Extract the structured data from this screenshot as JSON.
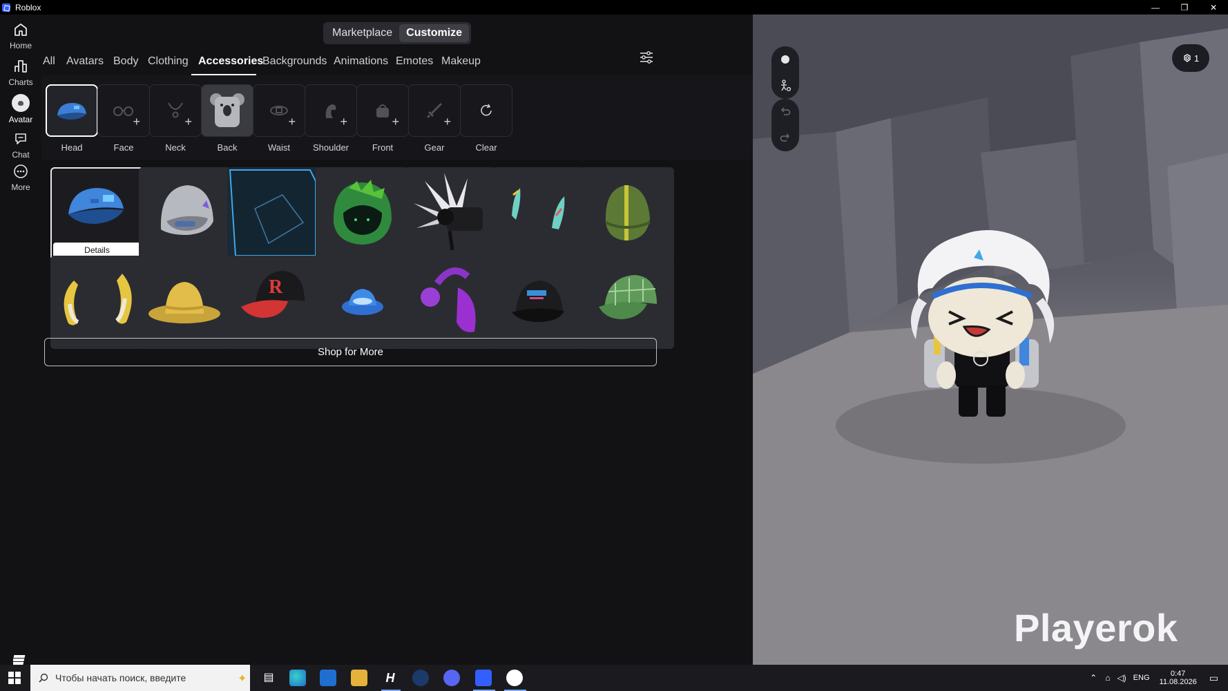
{
  "window": {
    "title": "Roblox",
    "minimize": "—",
    "restore": "❐",
    "close": "✕"
  },
  "nav": {
    "items": [
      {
        "label": "Home",
        "icon": "home-icon"
      },
      {
        "label": "Charts",
        "icon": "charts-icon"
      },
      {
        "label": "Avatar",
        "icon": "avatar-icon"
      },
      {
        "label": "Chat",
        "icon": "chat-icon"
      },
      {
        "label": "More",
        "icon": "more-icon"
      }
    ]
  },
  "header": {
    "segments": [
      "Marketplace",
      "Customize"
    ],
    "active_segment": "Customize"
  },
  "tabs": [
    "All",
    "Avatars",
    "Body",
    "Clothing",
    "Accessories",
    "Backgrounds",
    "Animations",
    "Emotes",
    "Makeup"
  ],
  "active_tab": "Accessories",
  "subcategories": [
    "Head",
    "Face",
    "Neck",
    "Back",
    "Waist",
    "Shoulder",
    "Front",
    "Gear",
    "Clear"
  ],
  "active_subcategory": "Head",
  "items": {
    "details_label": "Details",
    "list": [
      "blue-cap",
      "silver-helmet",
      "blue-box",
      "green-hood",
      "white-spikes",
      "feather-pair",
      "green-bandana",
      "banana-horns",
      "yellow-hat",
      "red-r-cap",
      "blue-fedora",
      "purple-headphones",
      "black-cap",
      "green-plaid-cap"
    ]
  },
  "shop_label": "Shop for More",
  "viewport": {
    "badge_count": "1",
    "watermark": "Playerok"
  },
  "taskbar": {
    "search_placeholder": "Чтобы начать поиск, введите",
    "lang": "ENG",
    "time": "0:47",
    "date": "11.08.2026"
  },
  "colors": {
    "accent": "#335fff",
    "bg": "#121215",
    "tile": "#2b2c31"
  }
}
